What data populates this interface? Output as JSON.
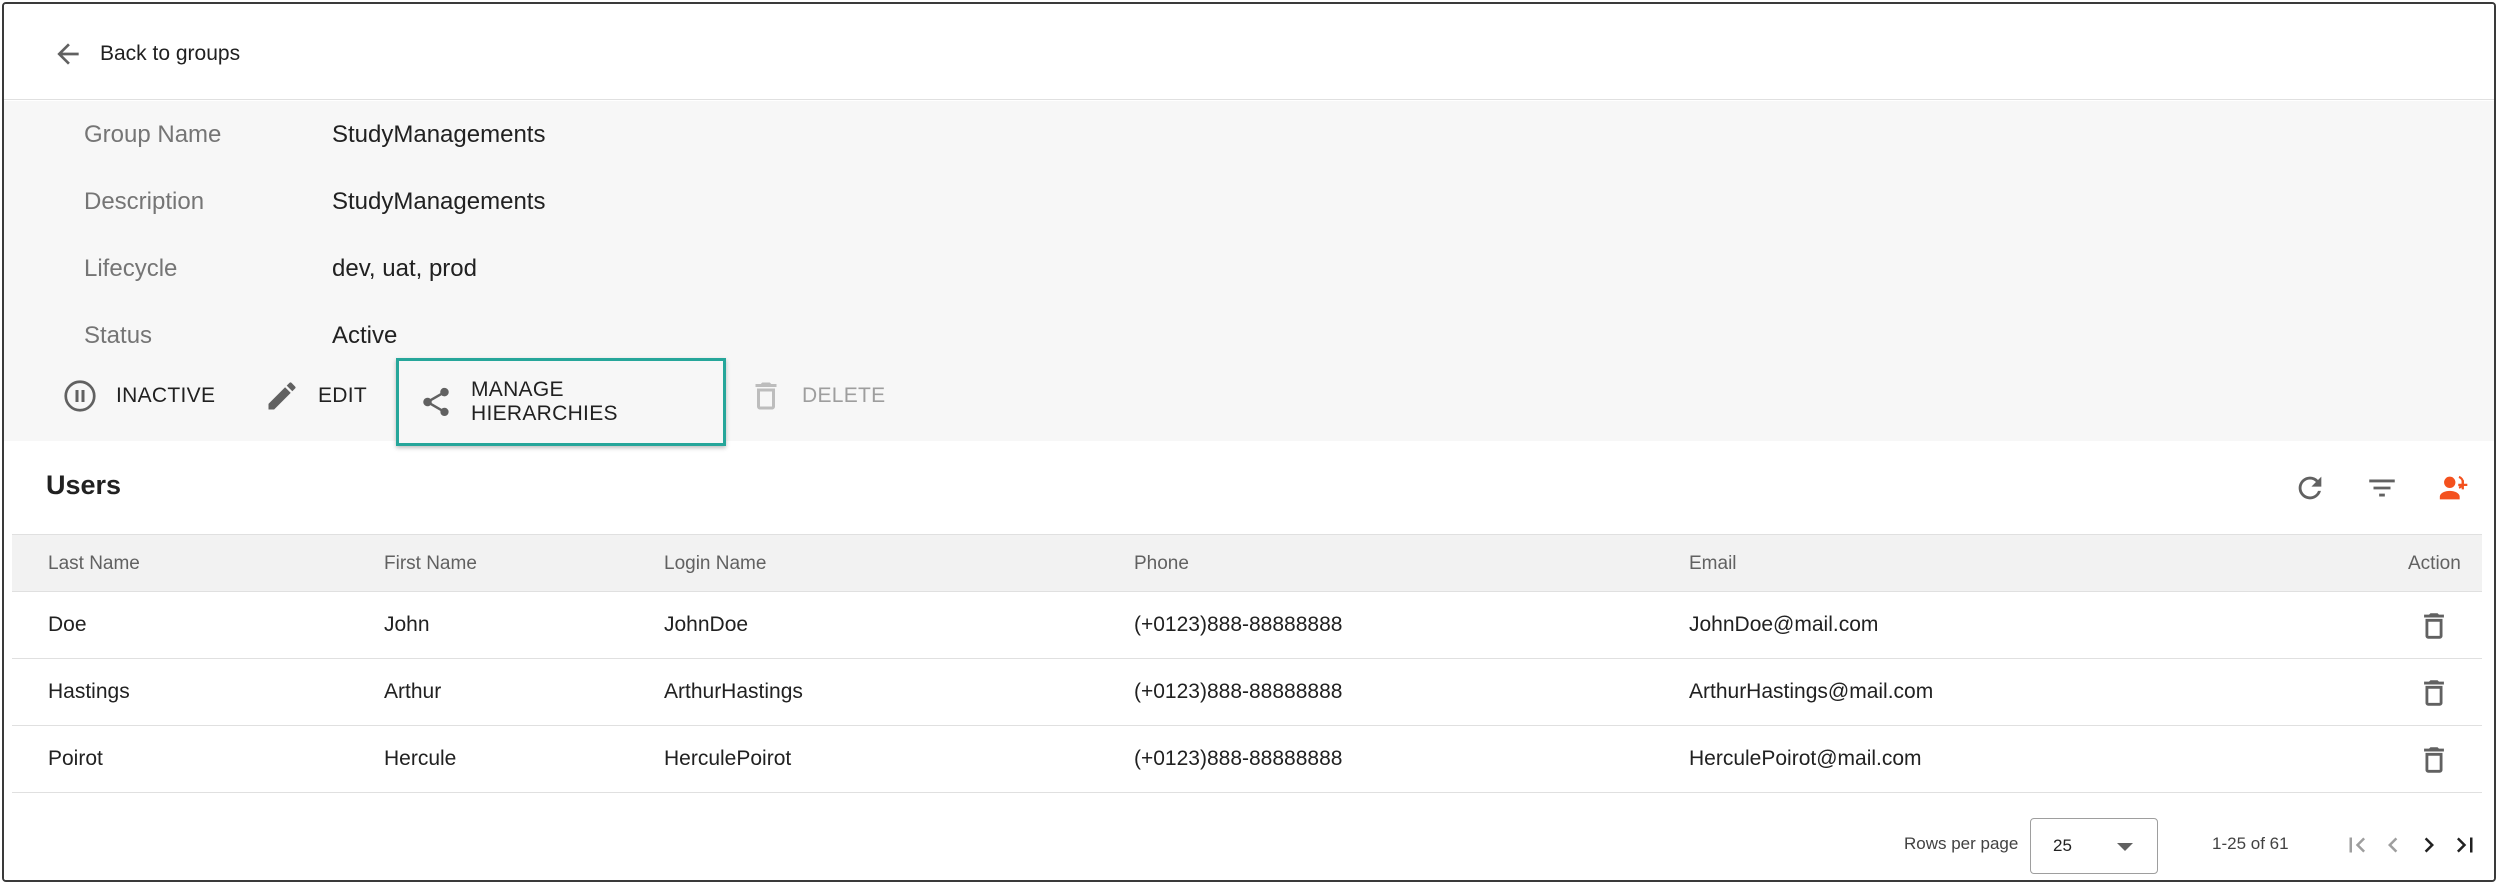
{
  "nav": {
    "back_label": "Back to groups"
  },
  "group": {
    "fields": [
      {
        "label": "Group Name",
        "value": "StudyManagements"
      },
      {
        "label": "Description",
        "value": "StudyManagements"
      },
      {
        "label": "Lifecycle",
        "value": "dev, uat, prod"
      },
      {
        "label": "Status",
        "value": "Active"
      }
    ],
    "actions": {
      "inactive": "INACTIVE",
      "edit": "EDIT",
      "manage_hierarchies": "MANAGE HIERARCHIES",
      "delete": "DELETE"
    }
  },
  "users": {
    "title": "Users",
    "columns": [
      "Last Name",
      "First Name",
      "Login Name",
      "Phone",
      "Email",
      "Action"
    ],
    "rows": [
      {
        "last": "Doe",
        "first": "John",
        "login": "JohnDoe",
        "phone": "(+0123)888-88888888",
        "email": "JohnDoe@mail.com"
      },
      {
        "last": "Hastings",
        "first": "Arthur",
        "login": "ArthurHastings",
        "phone": "(+0123)888-88888888",
        "email": "ArthurHastings@mail.com"
      },
      {
        "last": "Poirot",
        "first": "Hercule",
        "login": "HerculePoirot",
        "phone": "(+0123)888-88888888",
        "email": "HerculePoirot@mail.com"
      }
    ]
  },
  "pagination": {
    "rows_per_page_label": "Rows per page",
    "rows_per_page_value": "25",
    "range": "1-25 of 61"
  },
  "colors": {
    "highlight_border": "#26a69a",
    "add_user_accent": "#f4511e",
    "details_background": "#f7f7f7"
  },
  "icons": {
    "back": "arrow-left-icon",
    "inactive": "pause-circle-icon",
    "edit": "pencil-icon",
    "manage_hierarchies": "share-icon",
    "delete": "trash-icon",
    "refresh": "refresh-icon",
    "filter": "filter-icon",
    "add_user": "add-user-icon"
  }
}
